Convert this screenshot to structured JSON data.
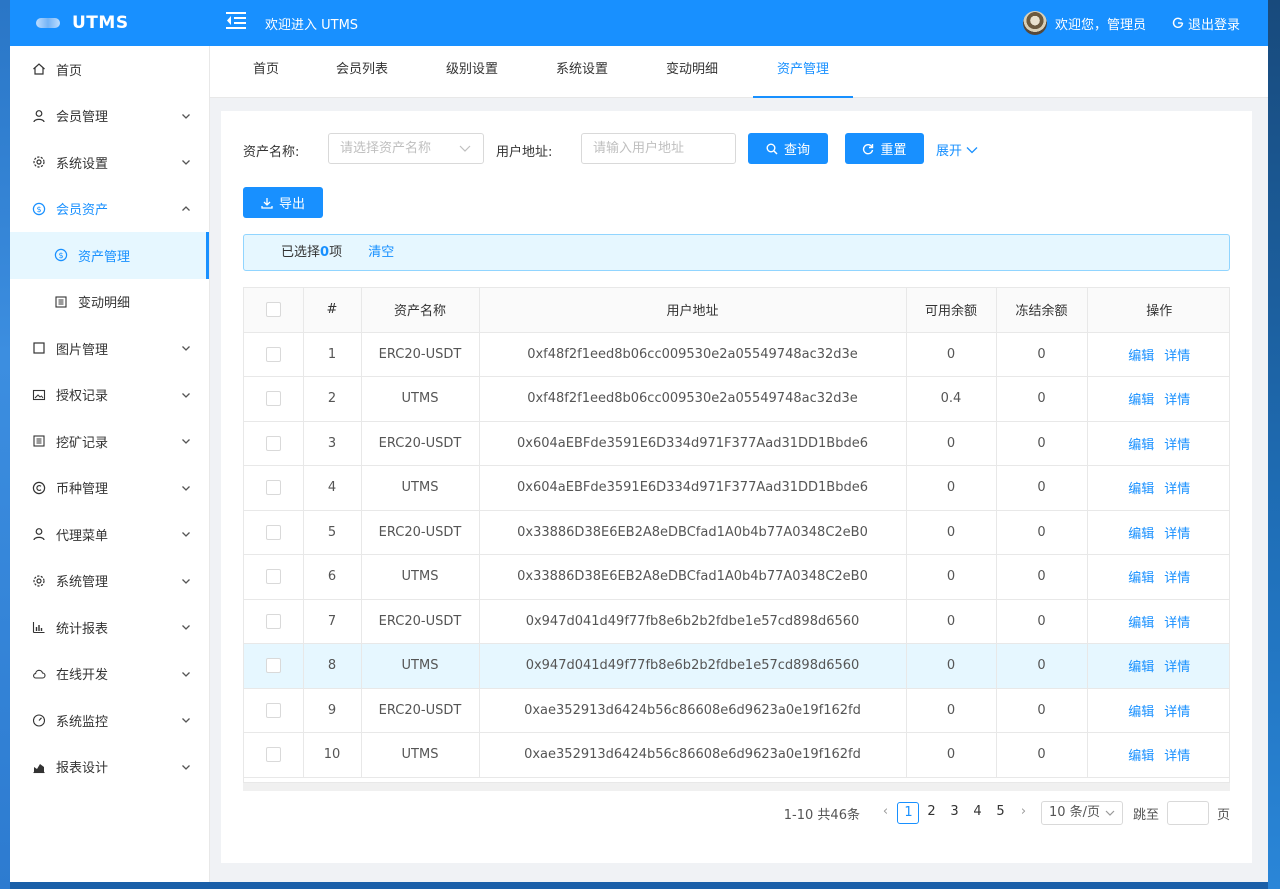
{
  "header": {
    "logo_text": "UTMS",
    "title": "欢迎进入 UTMS",
    "welcome": "欢迎您，管理员",
    "logout": "退出登录"
  },
  "sidebar": {
    "items": [
      {
        "label": "首页",
        "icon": "home-icon"
      },
      {
        "label": "会员管理",
        "icon": "user-icon"
      },
      {
        "label": "系统设置",
        "icon": "gear-icon"
      },
      {
        "label": "会员资产",
        "icon": "coin-icon",
        "open": true
      },
      {
        "label": "资产管理",
        "icon": "coin-icon",
        "sub": true,
        "active": true
      },
      {
        "label": "变动明细",
        "icon": "list-icon",
        "sub": true
      },
      {
        "label": "图片管理",
        "icon": "square-icon"
      },
      {
        "label": "授权记录",
        "icon": "image-icon"
      },
      {
        "label": "挖矿记录",
        "icon": "list-icon"
      },
      {
        "label": "币种管理",
        "icon": "copyright-icon"
      },
      {
        "label": "代理菜单",
        "icon": "user-icon"
      },
      {
        "label": "系统管理",
        "icon": "gear-icon"
      },
      {
        "label": "统计报表",
        "icon": "bar-chart-icon"
      },
      {
        "label": "在线开发",
        "icon": "cloud-icon"
      },
      {
        "label": "系统监控",
        "icon": "dashboard-icon"
      },
      {
        "label": "报表设计",
        "icon": "area-chart-icon"
      }
    ]
  },
  "tabs": [
    {
      "label": "首页"
    },
    {
      "label": "会员列表"
    },
    {
      "label": "级别设置"
    },
    {
      "label": "系统设置"
    },
    {
      "label": "变动明细"
    },
    {
      "label": "资产管理",
      "active": true
    }
  ],
  "filters": {
    "asset_label": "资产名称:",
    "asset_placeholder": "请选择资产名称",
    "address_label": "用户地址:",
    "address_placeholder": "请输入用户地址",
    "query": "查询",
    "reset": "重置",
    "expand": "展开",
    "export": "导出"
  },
  "selection": {
    "prefix": "已选择",
    "count": "0",
    "suffix": "项",
    "clear": "清空"
  },
  "table": {
    "columns": [
      "#",
      "资产名称",
      "用户地址",
      "可用余额",
      "冻结余额",
      "操作"
    ],
    "actions": [
      "编辑",
      "详情"
    ],
    "rows": [
      {
        "no": "1",
        "name": "ERC20-USDT",
        "address": "0xf48f2f1eed8b06cc009530e2a05549748ac32d3e",
        "available": "0",
        "frozen": "0"
      },
      {
        "no": "2",
        "name": "UTMS",
        "address": "0xf48f2f1eed8b06cc009530e2a05549748ac32d3e",
        "available": "0.4",
        "frozen": "0"
      },
      {
        "no": "3",
        "name": "ERC20-USDT",
        "address": "0x604aEBFde3591E6D334d971F377Aad31DD1Bbde6",
        "available": "0",
        "frozen": "0"
      },
      {
        "no": "4",
        "name": "UTMS",
        "address": "0x604aEBFde3591E6D334d971F377Aad31DD1Bbde6",
        "available": "0",
        "frozen": "0"
      },
      {
        "no": "5",
        "name": "ERC20-USDT",
        "address": "0x33886D38E6EB2A8eDBCfad1A0b4b77A0348C2eB0",
        "available": "0",
        "frozen": "0"
      },
      {
        "no": "6",
        "name": "UTMS",
        "address": "0x33886D38E6EB2A8eDBCfad1A0b4b77A0348C2eB0",
        "available": "0",
        "frozen": "0"
      },
      {
        "no": "7",
        "name": "ERC20-USDT",
        "address": "0x947d041d49f77fb8e6b2b2fdbe1e57cd898d6560",
        "available": "0",
        "frozen": "0"
      },
      {
        "no": "8",
        "name": "UTMS",
        "address": "0x947d041d49f77fb8e6b2b2fdbe1e57cd898d6560",
        "available": "0",
        "frozen": "0",
        "highlight": true
      },
      {
        "no": "9",
        "name": "ERC20-USDT",
        "address": "0xae352913d6424b56c86608e6d9623a0e19f162fd",
        "available": "0",
        "frozen": "0"
      },
      {
        "no": "10",
        "name": "UTMS",
        "address": "0xae352913d6424b56c86608e6d9623a0e19f162fd",
        "available": "0",
        "frozen": "0"
      }
    ]
  },
  "pagination": {
    "total_text": "1-10 共46条",
    "pages": [
      "1",
      "2",
      "3",
      "4",
      "5"
    ],
    "current": "1",
    "page_size": "10 条/页",
    "jump_label": "跳至",
    "page_suffix": "页"
  },
  "colors": {
    "primary": "#1890ff",
    "highlight_row": "#e6f7ff"
  }
}
